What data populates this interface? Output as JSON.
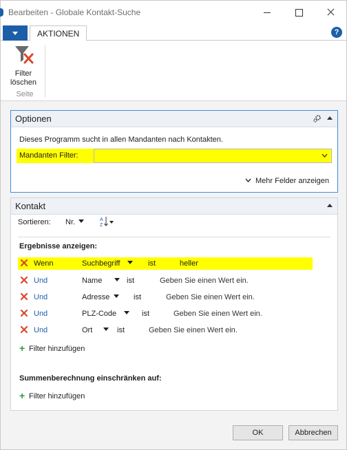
{
  "window": {
    "title": "Bearbeiten - Globale Kontakt-Suche"
  },
  "ribbon": {
    "tab_actions": "AKTIONEN",
    "help_symbol": "?",
    "clear_filter_line1": "Filter",
    "clear_filter_line2": "löschen",
    "group_label": "Seite"
  },
  "options": {
    "header": "Optionen",
    "description": "Dieses Programm sucht in allen Mandanten nach Kontakten.",
    "company_filter_label": "Mandanten Filter:",
    "company_filter_value": "",
    "more_fields": "Mehr Felder anzeigen"
  },
  "contact": {
    "header": "Kontakt",
    "sort_label": "Sortieren:",
    "sort_value": "Nr.",
    "results_title": "Ergebnisse anzeigen:",
    "criteria": [
      {
        "op": "Wenn",
        "field": "Suchbegriff",
        "ist": "ist",
        "value": "heller",
        "highlight": true
      },
      {
        "op": "Und",
        "field": "Name",
        "ist": "ist",
        "value": "Geben Sie einen Wert ein."
      },
      {
        "op": "Und",
        "field": "Adresse",
        "ist": "ist",
        "value": "Geben Sie einen Wert ein."
      },
      {
        "op": "Und",
        "field": "PLZ-Code",
        "ist": "ist",
        "value": "Geben Sie einen Wert ein."
      },
      {
        "op": "Und",
        "field": "Ort",
        "ist": "ist",
        "value": "Geben Sie einen Wert ein."
      }
    ],
    "add_filter": "Filter hinzufügen",
    "totals_title": "Summenberechnung einschränken auf:",
    "add_filter_totals": "Filter hinzufügen"
  },
  "footer": {
    "ok": "OK",
    "cancel": "Abbrechen"
  },
  "colors": {
    "accent": "#1c5fa8",
    "highlight": "#ffff00",
    "remove_x": "#d9472b",
    "add_plus": "#2e9a3a"
  }
}
